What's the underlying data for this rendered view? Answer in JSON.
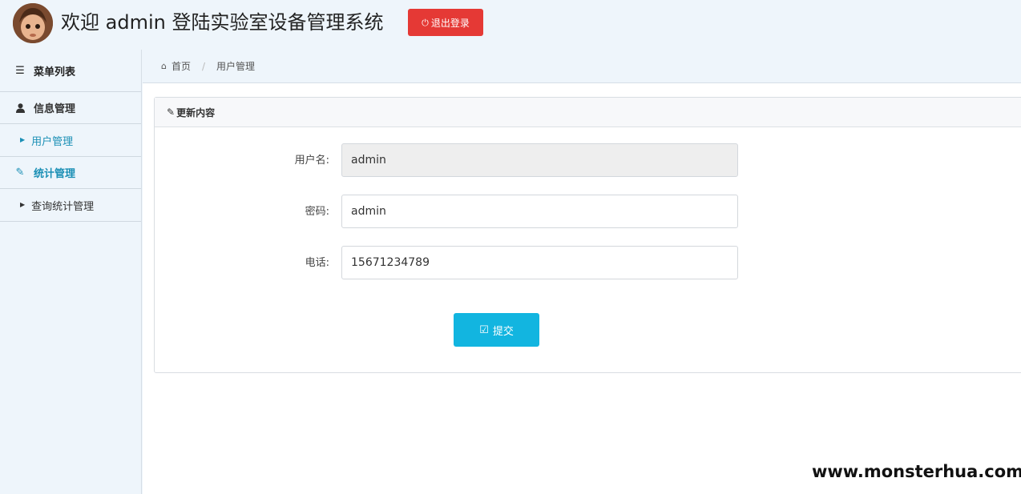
{
  "header": {
    "title": "欢迎 admin 登陆实验室设备管理系统",
    "logout_label": "退出登录"
  },
  "sidebar": {
    "heading": "菜单列表",
    "groups": [
      {
        "label": "信息管理",
        "items": [
          {
            "label": "用户管理"
          }
        ]
      },
      {
        "label": "统计管理",
        "items": [
          {
            "label": "查询统计管理"
          }
        ]
      }
    ]
  },
  "breadcrumb": {
    "home": "首页",
    "current": "用户管理"
  },
  "panel": {
    "title": "更新内容",
    "fields": [
      {
        "label": "用户名:",
        "value": "admin"
      },
      {
        "label": "密码:",
        "value": "admin"
      },
      {
        "label": "电话:",
        "value": "15671234789"
      }
    ],
    "submit_label": "提交"
  },
  "watermark": "www.monsterhua.com",
  "colors": {
    "logout": "#e53935",
    "submit": "#12b5e0",
    "active_link": "#1a8fb5",
    "background": "#eef5fb"
  }
}
